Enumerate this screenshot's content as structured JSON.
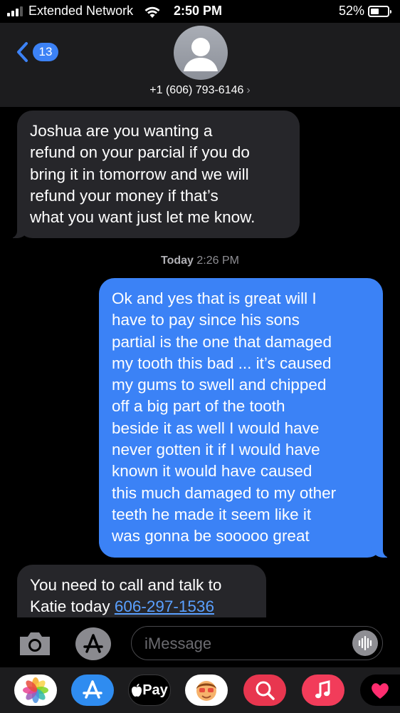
{
  "status_bar": {
    "carrier": "Extended Network",
    "time": "2:50 PM",
    "battery_percent": "52%",
    "battery_level": 0.52,
    "signal_bars": 3
  },
  "header": {
    "back_count": "13",
    "contact": "+1 (606) 793-6146",
    "chevron": "›"
  },
  "messages": [
    {
      "direction": "incoming",
      "lines": [
        "Joshua are you wanting a",
        "refund on your parcial if you do",
        "bring it in tomorrow and we will",
        "refund your money if that’s",
        "what you want just let me know."
      ]
    },
    {
      "direction": "outgoing",
      "lines": [
        "Ok and yes that is great will I",
        "have to pay since his sons",
        "partial is the one that damaged",
        "my tooth this bad ... it’s caused",
        "my gums to swell and chipped",
        "off a big part of the tooth",
        "beside it as well I would have",
        "never gotten it if I would have",
        "known it would have caused",
        "this much damaged to my other",
        "teeth he made it seem like it",
        "was gonna be sooooo great"
      ]
    },
    {
      "direction": "incoming",
      "lines": [
        "You need to call and talk to",
        "Katie today"
      ],
      "link": "606-297-1536"
    }
  ],
  "timestamp": {
    "day": "Today",
    "time": "2:26 PM"
  },
  "input": {
    "placeholder": "iMessage"
  },
  "icons": {
    "camera": "camera-icon",
    "app_store": "app-store-icon",
    "audio": "audio-waveform-icon",
    "back": "chevron-left-icon"
  },
  "app_drawer": {
    "apple_pay_label": "Pay",
    "items": [
      "photos-app",
      "app-store-app",
      "apple-pay-app",
      "memoji-app",
      "image-search-app",
      "music-app",
      "digital-touch-app"
    ]
  },
  "colors": {
    "outgoing_bubble": "#3b82f6",
    "incoming_bubble": "#26262a",
    "link": "#5aa0ff",
    "header_bg": "#1c1c1e"
  }
}
